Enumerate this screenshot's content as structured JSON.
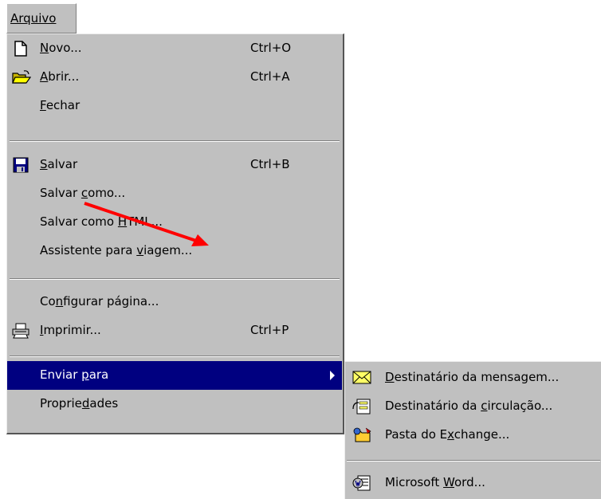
{
  "menubar": {
    "label": "Arquivo"
  },
  "menu": {
    "items": [
      {
        "label_pre": "",
        "accel": "N",
        "label_post": "ovo...",
        "shortcut": "Ctrl+O",
        "icon": "new-document-icon"
      },
      {
        "label_pre": "",
        "accel": "A",
        "label_post": "brir...",
        "shortcut": "Ctrl+A",
        "icon": "open-folder-icon"
      },
      {
        "label_pre": "",
        "accel": "F",
        "label_post": "echar",
        "shortcut": ""
      },
      {
        "label_pre": "",
        "accel": "S",
        "label_post": "alvar",
        "shortcut": "Ctrl+B",
        "icon": "save-disk-icon"
      },
      {
        "label_pre": "Salvar ",
        "accel": "c",
        "label_post": "omo...",
        "shortcut": ""
      },
      {
        "label_pre": "Salvar como ",
        "accel": "H",
        "label_post": "TML...",
        "shortcut": ""
      },
      {
        "label_pre": "Assistente para ",
        "accel": "v",
        "label_post": "iagem...",
        "shortcut": ""
      },
      {
        "label_pre": "Co",
        "accel": "n",
        "label_post": "figurar página...",
        "shortcut": ""
      },
      {
        "label_pre": "",
        "accel": "I",
        "label_post": "mprimir...",
        "shortcut": "Ctrl+P",
        "icon": "printer-icon"
      },
      {
        "label_pre": "Enviar ",
        "accel": "p",
        "label_post": "ara",
        "shortcut": "",
        "selected": true
      },
      {
        "label_pre": "Proprie",
        "accel": "d",
        "label_post": "ades",
        "shortcut": ""
      }
    ]
  },
  "submenu": {
    "items": [
      {
        "label_pre": "",
        "accel": "D",
        "label_post": "estinatário da mensagem...",
        "icon": "mail-envelope-icon"
      },
      {
        "label_pre": "Destinatário da ",
        "accel": "c",
        "label_post": "irculação...",
        "icon": "routing-slip-icon"
      },
      {
        "label_pre": "Pasta do E",
        "accel": "x",
        "label_post": "change...",
        "icon": "exchange-folder-icon"
      },
      {
        "label_pre": "Microsoft ",
        "accel": "W",
        "label_post": "ord...",
        "icon": "word-icon"
      }
    ]
  },
  "colors": {
    "menu_bg": "#c0c0c0",
    "highlight": "#000080",
    "annotation_arrow": "#ff0000"
  }
}
